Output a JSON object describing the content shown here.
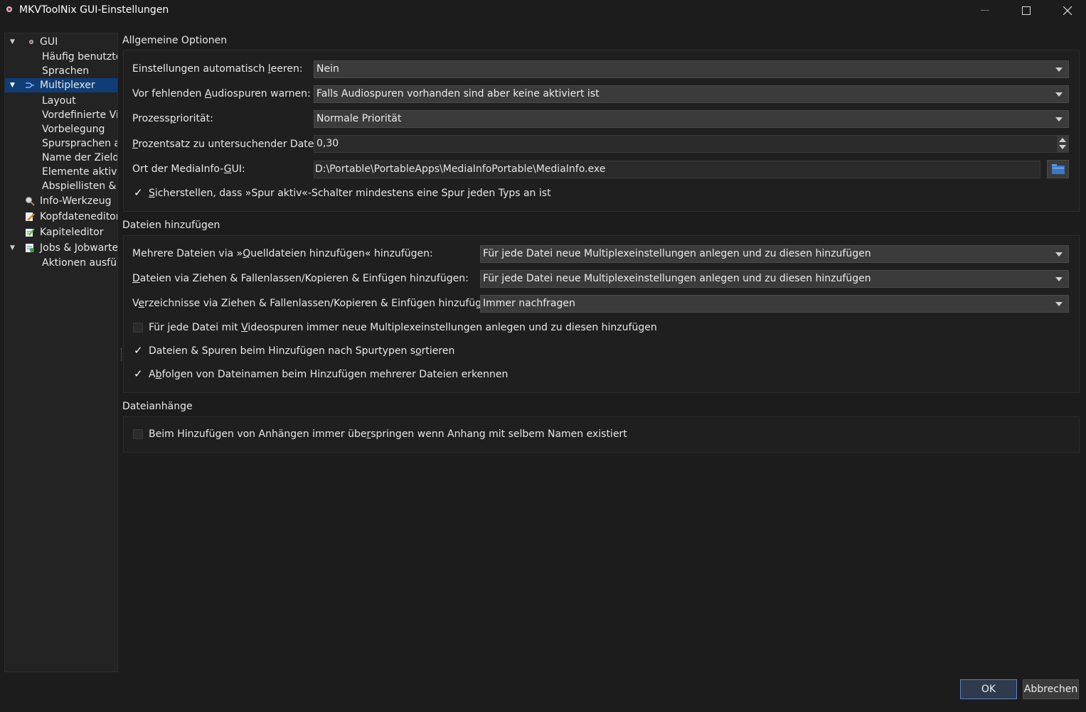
{
  "window": {
    "title": "MKVToolNix GUI-Einstellungen"
  },
  "nav": {
    "items": [
      {
        "label": "GUI"
      },
      {
        "label": "Häufig benutzte"
      },
      {
        "label": "Sprachen"
      },
      {
        "label": "Multiplexer"
      },
      {
        "label": "Layout"
      },
      {
        "label": "Vordefinierte Vic"
      },
      {
        "label": "Vorbelegung"
      },
      {
        "label": "Spursprachen ab"
      },
      {
        "label": "Name der Zielda"
      },
      {
        "label": "Elemente aktivie"
      },
      {
        "label": "Abspiellisten & I"
      },
      {
        "label": "Info-Werkzeug"
      },
      {
        "label": "Kopfdateneditor"
      },
      {
        "label": "Kapiteleditor"
      },
      {
        "label": "Jobs & Jobwarte"
      },
      {
        "label": "Aktionen ausfüh"
      }
    ]
  },
  "general": {
    "title": "Allgemeine Optionen",
    "clear_label_pre": "Einstellungen automatisch ",
    "clear_label_u": "l",
    "clear_label_post": "eeren:",
    "clear_value": "Nein",
    "audio_label_pre": "Vor fehlenden ",
    "audio_label_u": "A",
    "audio_label_post": "udiospuren warnen:",
    "audio_value": "Falls Audiospuren vorhanden sind aber keine aktiviert ist",
    "priority_label_pre": "Prozess",
    "priority_label_u": "p",
    "priority_label_post": "riorität:",
    "priority_value": "Normale Priorität",
    "percent_label_u": "P",
    "percent_label_post": "rozentsatz zu untersuchender Daten:",
    "percent_value": "0,30",
    "mediainfo_label_pre": "Ort der MediaInfo-",
    "mediainfo_label_u": "G",
    "mediainfo_label_post": "UI:",
    "mediainfo_value": "D:\\Portable\\PortableApps\\MediaInfoPortable\\MediaInfo.exe",
    "ensure_u": "S",
    "ensure_post": "icherstellen, dass »Spur aktiv«-Schalter mindestens eine Spur jeden Typs an ist"
  },
  "add_files": {
    "title": "Dateien hinzufügen",
    "multi_pre": "Mehrere Dateien via »",
    "multi_u": "Q",
    "multi_post": "uelldateien hinzufügen« hinzufügen:",
    "multi_value": "Für jede Datei neue Multiplexeinstellungen anlegen und zu diesen hinzufügen",
    "drag_u": "D",
    "drag_post": "ateien via Ziehen & Fallenlassen/Kopieren & Einfügen hinzufügen:",
    "drag_value": "Für jede Datei neue Multiplexeinstellungen anlegen und zu diesen hinzufügen",
    "dirs_pre": "V",
    "dirs_u": "e",
    "dirs_post": "rzeichnisse via Ziehen & Fallenlassen/Kopieren & Einfügen hinzufügen:",
    "dirs_value": "Immer nachfragen",
    "video_pre": "Für jede Datei mit ",
    "video_u": "V",
    "video_post": "ideospuren immer neue Multiplexeinstellungen anlegen und zu diesen hinzufügen",
    "sort_pre": "Dateien & Spuren beim Hinzufügen nach Spurtypen s",
    "sort_u": "o",
    "sort_post": "rtieren",
    "seq_pre": "A",
    "seq_u": "b",
    "seq_post": "folgen von Dateinamen beim Hinzufügen mehrerer Dateien erkennen"
  },
  "attachments": {
    "title": "Dateianhänge",
    "skip_pre": "Beim Hinzufügen von Anhängen immer übe",
    "skip_u": "r",
    "skip_post": "springen wenn Anhang mit selbem Namen existiert"
  },
  "buttons": {
    "ok": "OK",
    "cancel": "Abbrechen"
  },
  "colors": {
    "selection": "#0f3d78",
    "ok_border": "#5a85c6"
  }
}
